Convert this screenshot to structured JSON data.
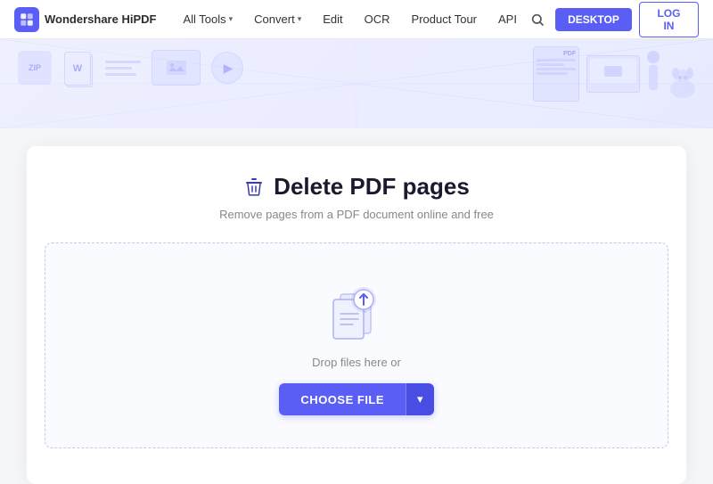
{
  "brand": {
    "name": "Wondershare HiPDF",
    "logo_color": "#5b5ef4"
  },
  "nav": {
    "items": [
      {
        "label": "All Tools",
        "has_dropdown": true
      },
      {
        "label": "Convert",
        "has_dropdown": true
      },
      {
        "label": "Edit",
        "has_dropdown": false
      },
      {
        "label": "OCR",
        "has_dropdown": false
      },
      {
        "label": "Product Tour",
        "has_dropdown": false
      },
      {
        "label": "API",
        "has_dropdown": false
      }
    ],
    "btn_desktop": "DESKTOP",
    "btn_login": "LOG IN"
  },
  "page": {
    "title": "Delete PDF pages",
    "subtitle": "Remove pages from a PDF document online and free",
    "drop_text": "Drop files here or",
    "choose_btn": "CHOOSE FILE",
    "choose_dropdown_icon": "▾"
  }
}
